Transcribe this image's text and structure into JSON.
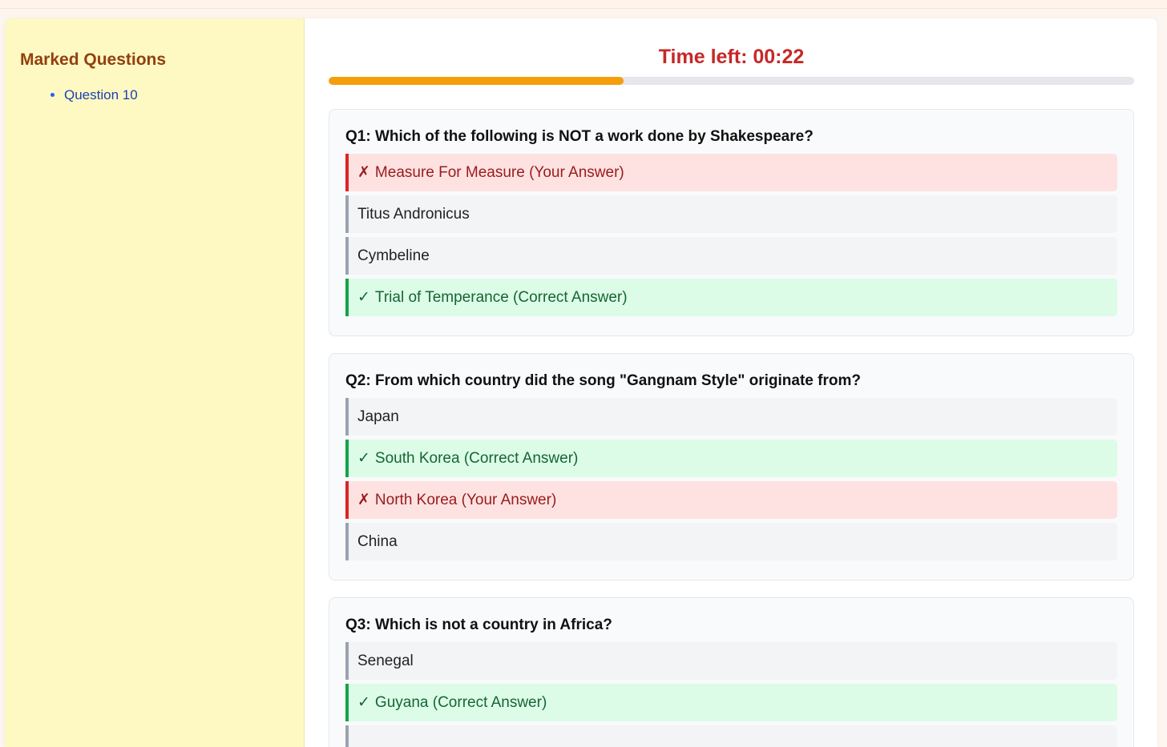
{
  "sidebar": {
    "title": "Marked Questions",
    "items": [
      {
        "label": "Question 10"
      }
    ]
  },
  "timer": {
    "text": "Time left: 00:22",
    "progress_fraction": 0.366
  },
  "colors": {
    "timer": "#c62828",
    "progress": "#f59e0b",
    "correct": "#16a34a",
    "wrong": "#dc2626"
  },
  "icons": {
    "correct": "✓",
    "wrong": "✗"
  },
  "questions": [
    {
      "text": "Q1: Which of the following is NOT a work done by Shakespeare?",
      "options": [
        {
          "label": "Measure For Measure (Your Answer)",
          "state": "wrong"
        },
        {
          "label": "Titus Andronicus",
          "state": "neutral"
        },
        {
          "label": "Cymbeline",
          "state": "neutral"
        },
        {
          "label": "Trial of Temperance (Correct Answer)",
          "state": "correct"
        }
      ]
    },
    {
      "text": "Q2: From which country did the song \"Gangnam Style\" originate from?",
      "options": [
        {
          "label": "Japan",
          "state": "neutral"
        },
        {
          "label": "South Korea (Correct Answer)",
          "state": "correct"
        },
        {
          "label": "North Korea (Your Answer)",
          "state": "wrong"
        },
        {
          "label": "China",
          "state": "neutral"
        }
      ]
    },
    {
      "text": "Q3: Which is not a country in Africa?",
      "options": [
        {
          "label": "Senegal",
          "state": "neutral"
        },
        {
          "label": "Guyana (Correct Answer)",
          "state": "correct"
        },
        {
          "label": "",
          "state": "neutral"
        }
      ]
    }
  ]
}
